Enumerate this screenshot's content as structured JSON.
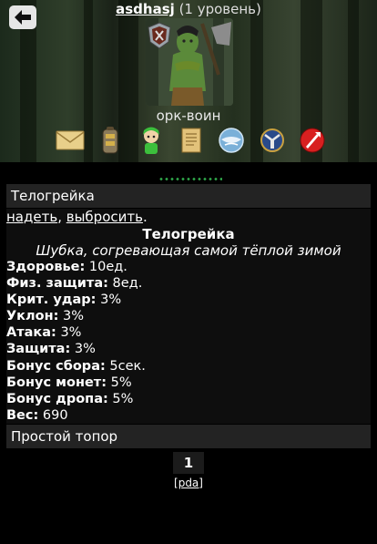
{
  "header": {
    "username": "asdhasj",
    "level_text": "(1 уровень)",
    "class_label": "орк-воин"
  },
  "menu_icons": [
    "mail-icon",
    "inventory-bag-icon",
    "friends-icon",
    "scroll-icon",
    "globe-icon",
    "guild-icon",
    "pvp-icon"
  ],
  "item_panel": {
    "title": "Телогрейка",
    "action_equip": "надеть",
    "separator": ", ",
    "action_drop": "выбросить",
    "end_punct": ".",
    "item_name": "Телогрейка",
    "item_description": "Шубка, согревающая самой тёплой зимой",
    "stats": [
      {
        "label": "Здоровье:",
        "value": "10ед."
      },
      {
        "label": "Физ. защита:",
        "value": "8ед."
      },
      {
        "label": "Крит. удар:",
        "value": "3%"
      },
      {
        "label": "Уклон:",
        "value": "3%"
      },
      {
        "label": "Атака:",
        "value": "3%"
      },
      {
        "label": "Защита:",
        "value": "3%"
      },
      {
        "label": "Бонус сбора:",
        "value": "5сек."
      },
      {
        "label": "Бонус монет:",
        "value": "5%"
      },
      {
        "label": "Бонус дропа:",
        "value": "5%"
      },
      {
        "label": "Вес:",
        "value": "690"
      }
    ]
  },
  "next_item": {
    "title": "Простой топор"
  },
  "pagination": {
    "current_page": "1",
    "pda_link": "[pda]"
  },
  "colors": {
    "background": "#000000",
    "panel": "#232323",
    "loading_dots": "#2fa84a"
  }
}
